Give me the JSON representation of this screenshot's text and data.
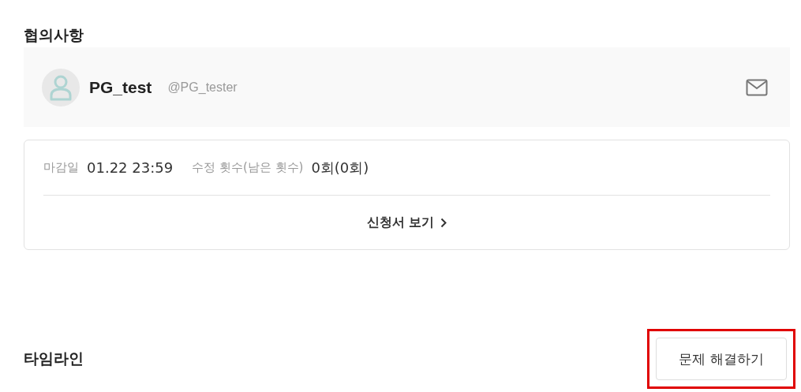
{
  "agreement": {
    "title": "협의사항",
    "profile": {
      "name": "PG_test",
      "handle": "@PG_tester"
    },
    "details": [
      {
        "label": "마감일",
        "value": "01.22 23:59"
      },
      {
        "label": "수정 횟수(남은 횟수)",
        "value": "0회(0회)"
      }
    ],
    "link": "신청서 보기"
  },
  "timeline": {
    "title": "타임라인",
    "button": {
      "label": "문제 해결하기",
      "highlighted": true
    }
  }
}
